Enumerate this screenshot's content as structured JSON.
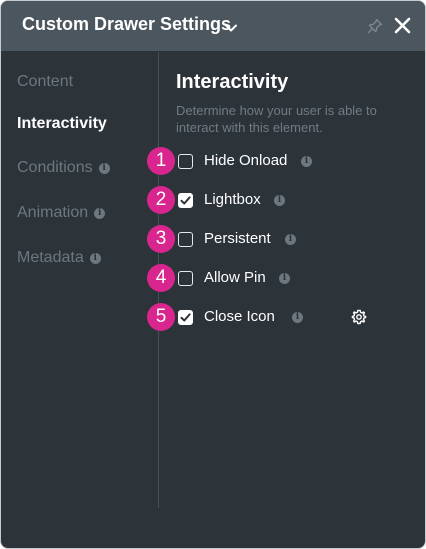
{
  "header": {
    "title": "Custom Drawer Settings",
    "chevron_icon": "chevron-down-icon",
    "pin_icon": "pin-icon",
    "close_icon": "close-icon"
  },
  "sidebar": {
    "items": [
      {
        "label": "Content",
        "active": false,
        "info": false
      },
      {
        "label": "Interactivity",
        "active": true,
        "info": false
      },
      {
        "label": "Conditions",
        "active": false,
        "info": true
      },
      {
        "label": "Animation",
        "active": false,
        "info": true
      },
      {
        "label": "Metadata",
        "active": false,
        "info": true
      }
    ],
    "info_glyph": "i"
  },
  "main": {
    "title": "Interactivity",
    "description": "Determine how your user is able to interact with this element.",
    "options": [
      {
        "badge": "1",
        "label": "Hide Onload",
        "checked": false
      },
      {
        "badge": "2",
        "label": "Lightbox",
        "checked": true
      },
      {
        "badge": "3",
        "label": "Persistent",
        "checked": false
      },
      {
        "badge": "4",
        "label": "Allow Pin",
        "checked": false
      },
      {
        "badge": "5",
        "label": "Close Icon",
        "checked": true,
        "gear_icon": "gear-icon"
      }
    ]
  },
  "colors": {
    "panel_bg": "#2c3339",
    "header_bg": "#4c565e",
    "badge": "#d9268e",
    "muted_text": "#6d777f"
  }
}
